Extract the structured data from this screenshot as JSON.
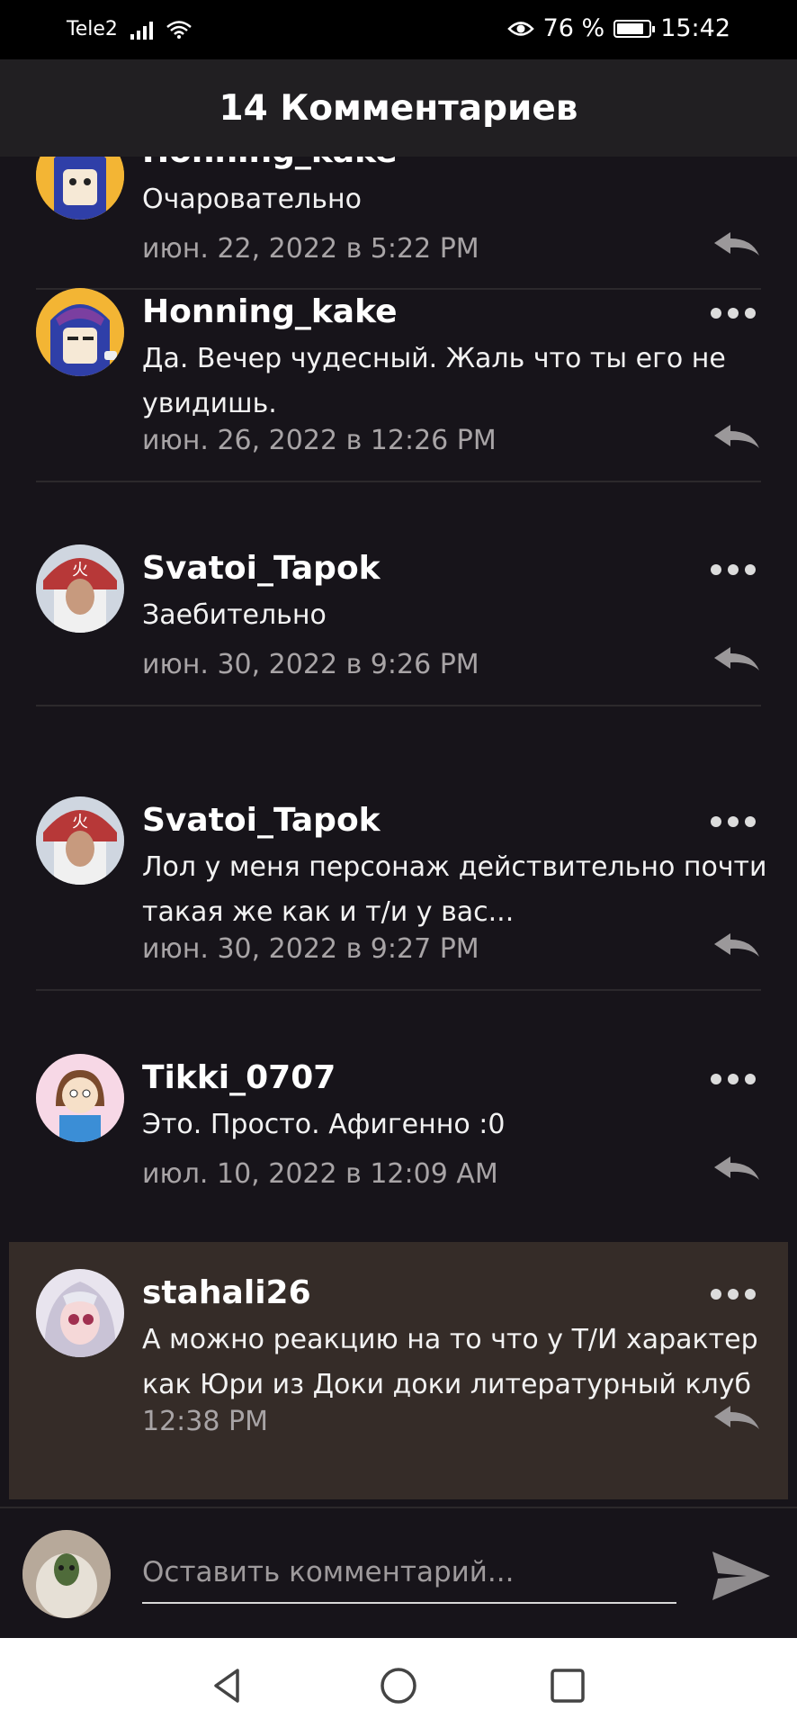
{
  "status_bar": {
    "carrier": "Tele2",
    "battery": "76 %",
    "time": "15:42",
    "icons": [
      "signal-icon",
      "wifi-icon",
      "eye-comfort-icon",
      "battery-icon"
    ]
  },
  "header": {
    "title": "14 Комментариев"
  },
  "comments": [
    {
      "user": "Honning_kake",
      "text": "Очаровательно",
      "date": "июн. 22, 2022 в 5:22 PM"
    },
    {
      "user": "Honning_kake",
      "text": "Да. Вечер чудесный. Жаль что ты его не увидишь.",
      "date": "июн. 26, 2022 в 12:26 PM"
    },
    {
      "user": "Svatoi_Tapok",
      "text": "Заебительно",
      "date": "июн. 30, 2022 в 9:26 PM"
    },
    {
      "user": "Svatoi_Tapok",
      "text": "Лол у меня персонаж действительно почти такая же как и т/и у вас...",
      "date": "июн. 30, 2022 в 9:27 PM"
    },
    {
      "user": "Tikki_0707",
      "text": "Это. Просто. Афигенно :0",
      "date": "июл. 10, 2022 в 12:09 AM"
    },
    {
      "user": "stahali26",
      "text": "А можно реакцию на то что у Т/И характер как Юри из Доки доки литературный клуб",
      "date": "12:38 PM"
    }
  ],
  "composer": {
    "placeholder": "Оставить комментарий..."
  },
  "colors": {
    "background": "#17141a",
    "header": "#211f22",
    "highlight": "#352c28",
    "date_text": "#a8a4a6"
  }
}
